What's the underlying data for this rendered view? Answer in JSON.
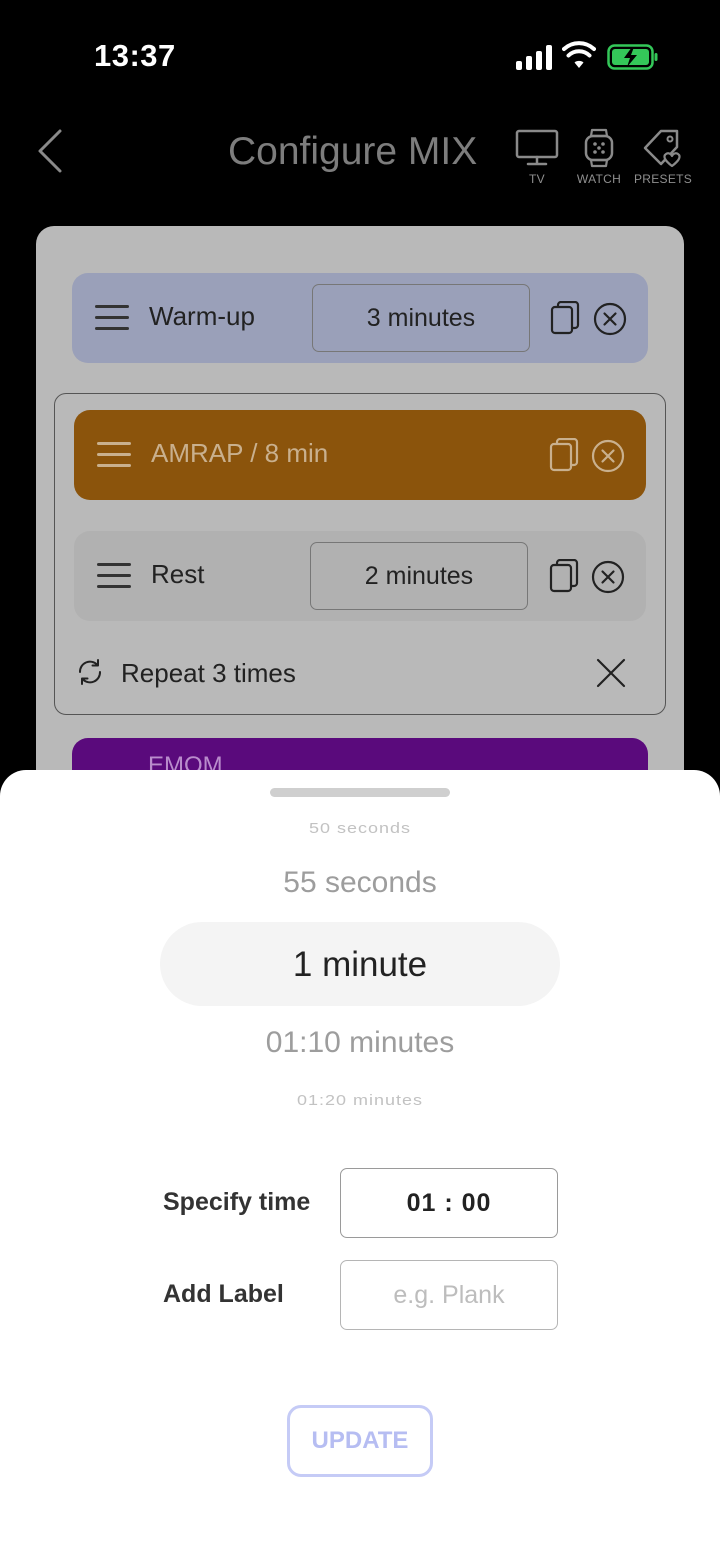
{
  "status_bar": {
    "time": "13:37",
    "battery_color": "#34c759"
  },
  "header": {
    "title": "Configure MIX",
    "actions": [
      {
        "label": "TV",
        "icon": "tv-icon"
      },
      {
        "label": "WATCH",
        "icon": "watch-icon"
      },
      {
        "label": "PRESETS",
        "icon": "presets-tag-icon"
      }
    ]
  },
  "workout": {
    "warmup": {
      "label": "Warm-up",
      "duration": "3 minutes",
      "color": "#9aa0b9"
    },
    "round": {
      "amrap": {
        "label": "AMRAP / 8 min",
        "color": "#8b540c"
      },
      "rest": {
        "label": "Rest",
        "duration": "2 minutes"
      },
      "repeat": {
        "label": "Repeat 3 times"
      }
    },
    "emom": {
      "label": "EMOM",
      "color": "#5a0a7c"
    }
  },
  "sheet": {
    "picker_items": [
      "50 seconds",
      "55 seconds",
      "1 minute",
      "01:10 minutes",
      "01:20 minutes"
    ],
    "selected": "1 minute",
    "specify_time_label": "Specify time",
    "specify_time_value": "01 : 00",
    "add_label_label": "Add Label",
    "add_label_placeholder": "e.g. Plank",
    "update_label": "UPDATE",
    "accent_color": "#b6bdf2"
  }
}
